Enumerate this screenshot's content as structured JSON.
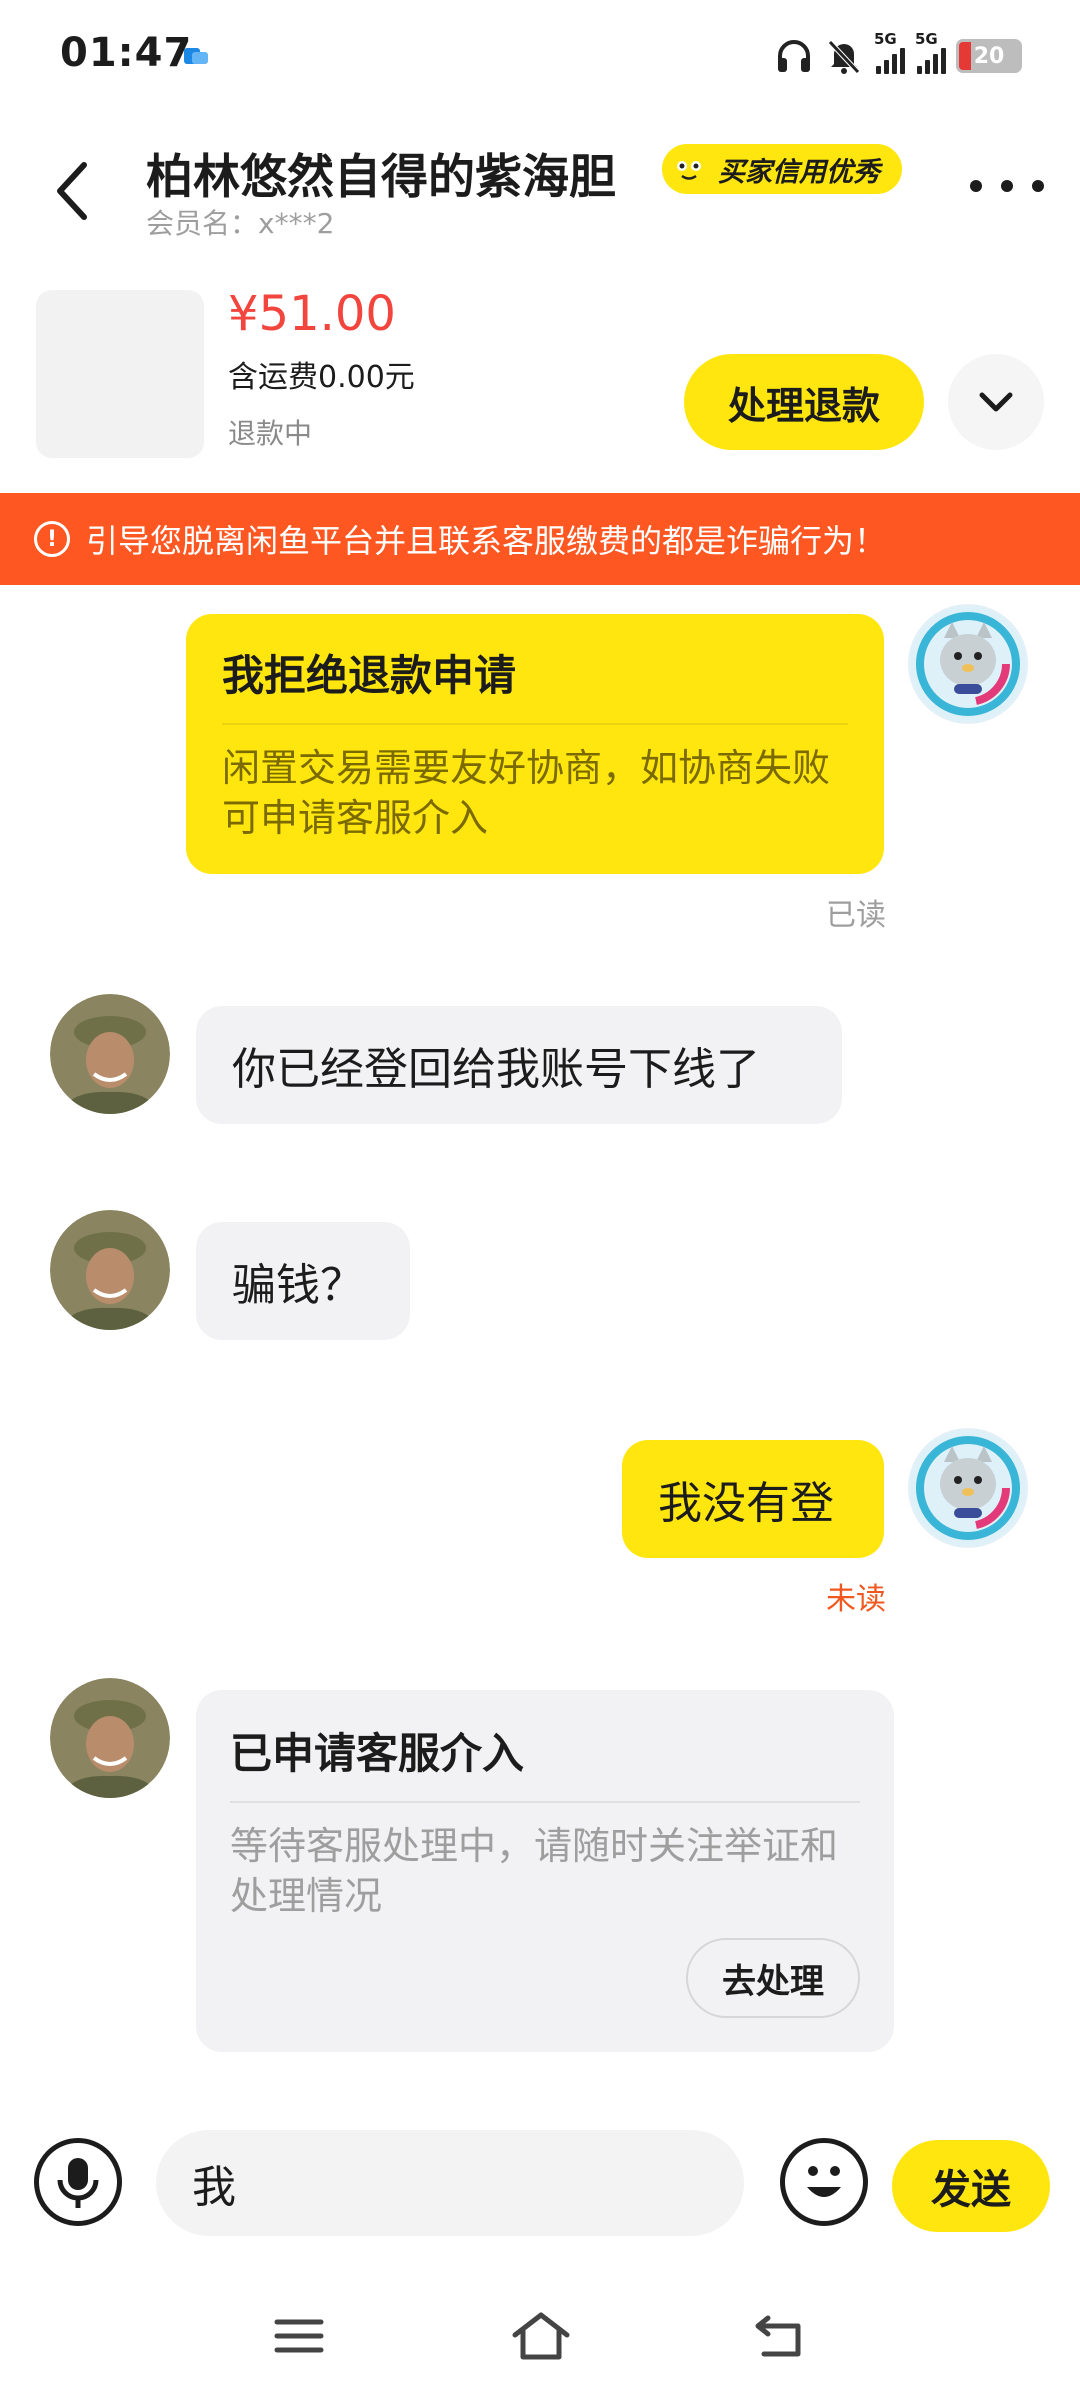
{
  "status_bar": {
    "time": "01:47",
    "network_1": "5G",
    "network_2": "5G",
    "battery": "20",
    "battery_level": 0.2
  },
  "header": {
    "title": "柏林悠然自得的紫海胆",
    "badge": "买家信用优秀",
    "member": "会员名：x***2"
  },
  "product": {
    "price": "¥51.00",
    "shipping": "含运费0.00元",
    "status": "退款中",
    "refund_button": "处理退款"
  },
  "warning": {
    "text": "引导您脱离闲鱼平台并且联系客服缴费的都是诈骗行为！"
  },
  "messages": {
    "m1_title": "我拒绝退款申请",
    "m1_body": "闲置交易需要友好协商，如协商失败可申请客服介入",
    "m1_read": "已读",
    "m2": "你已经登回给我账号下线了",
    "m3": "骗钱？",
    "m4": "我没有登",
    "m4_read": "未读",
    "m5_title": "已申请客服介入",
    "m5_body": "等待客服处理中，请随时关注举证和处理情况",
    "m5_action": "去处理"
  },
  "input": {
    "value": "我",
    "send": "发送"
  },
  "colors": {
    "accent_yellow": "#ffe60f",
    "warning_orange": "#ff5722",
    "price_red": "#f2453d",
    "unread_orange": "#f0581f"
  }
}
